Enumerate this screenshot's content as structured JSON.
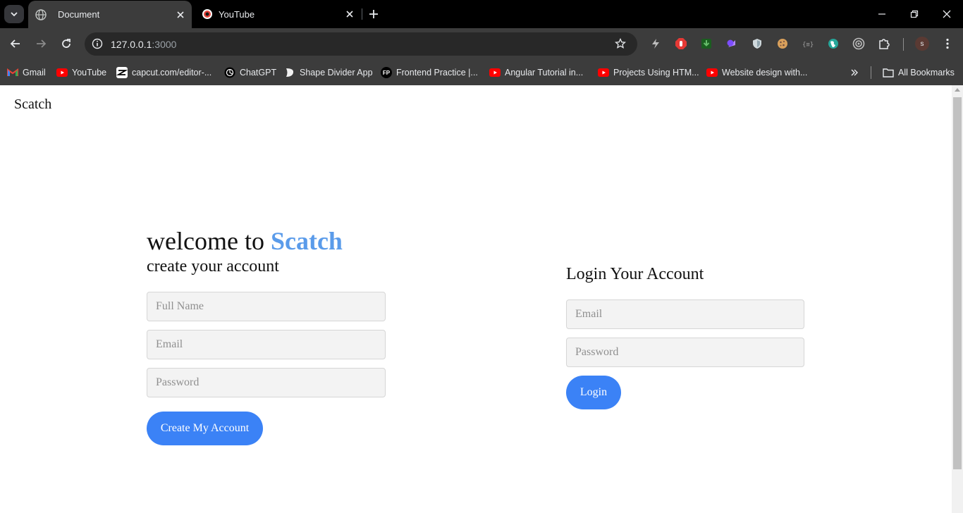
{
  "browser": {
    "tabs": [
      {
        "title": "Document",
        "active": true,
        "icon": "globe-icon"
      },
      {
        "title": "YouTube",
        "active": false,
        "icon": "youtube-recording-icon"
      }
    ],
    "url": {
      "host": "127.0.0.1",
      "port": ":3000"
    },
    "profile_initial": "s",
    "bookmarks": [
      {
        "label": "Gmail",
        "icon": "gmail-icon"
      },
      {
        "label": "YouTube",
        "icon": "youtube-icon"
      },
      {
        "label": "capcut.com/editor-...",
        "icon": "capcut-icon"
      },
      {
        "label": "ChatGPT",
        "icon": "chatgpt-icon"
      },
      {
        "label": "Shape Divider App",
        "icon": "shape-divider-icon"
      },
      {
        "label": "Frontend Practice |...",
        "icon": "fp-icon",
        "icon_text": "FP"
      },
      {
        "label": "Angular Tutorial in...",
        "icon": "youtube-icon"
      },
      {
        "label": "Projects Using HTM...",
        "icon": "youtube-icon"
      },
      {
        "label": "Website design with...",
        "icon": "youtube-icon"
      }
    ],
    "all_bookmarks_label": "All Bookmarks"
  },
  "page": {
    "brand": "Scatch",
    "welcome_prefix": "welcome to",
    "welcome_brand": "Scatch",
    "create_subtitle": "create your account",
    "signup": {
      "fullname_placeholder": "Full Name",
      "email_placeholder": "Email",
      "password_placeholder": "Password",
      "button_label": "Create My Account"
    },
    "login": {
      "title": "Login Your Account",
      "email_placeholder": "Email",
      "password_placeholder": "Password",
      "button_label": "Login"
    }
  },
  "colors": {
    "accent_button": "#3b82f6",
    "brand_highlight": "#5a9bea"
  }
}
